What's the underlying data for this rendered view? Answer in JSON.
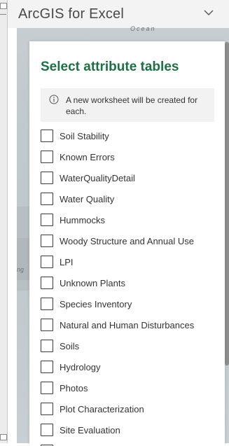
{
  "pane": {
    "title": "ArcGIS for Excel"
  },
  "map": {
    "label_top": "Ocean",
    "label_left": "ng"
  },
  "dialog": {
    "title": "Select attribute tables",
    "info_text": "A new worksheet will be created for each.",
    "info_icon": "info-icon",
    "tables": [
      {
        "label": "Soil Stability",
        "checked": false
      },
      {
        "label": "Known Errors",
        "checked": false
      },
      {
        "label": "WaterQualityDetail",
        "checked": false
      },
      {
        "label": "Water Quality",
        "checked": false
      },
      {
        "label": "Hummocks",
        "checked": false
      },
      {
        "label": "Woody Structure and Annual Use",
        "checked": false
      },
      {
        "label": "LPI",
        "checked": false
      },
      {
        "label": "Unknown Plants",
        "checked": false
      },
      {
        "label": "Species Inventory",
        "checked": false
      },
      {
        "label": "Natural and Human Disturbances",
        "checked": false
      },
      {
        "label": "Soils",
        "checked": false
      },
      {
        "label": "Hydrology",
        "checked": false
      },
      {
        "label": "Photos",
        "checked": false
      },
      {
        "label": "Plot Characterization",
        "checked": false
      },
      {
        "label": "Site Evaluation",
        "checked": false
      },
      {
        "label": "",
        "checked": false
      }
    ]
  },
  "colors": {
    "accent_green": "#1f6f44",
    "title_gray": "#4a4a4a"
  }
}
